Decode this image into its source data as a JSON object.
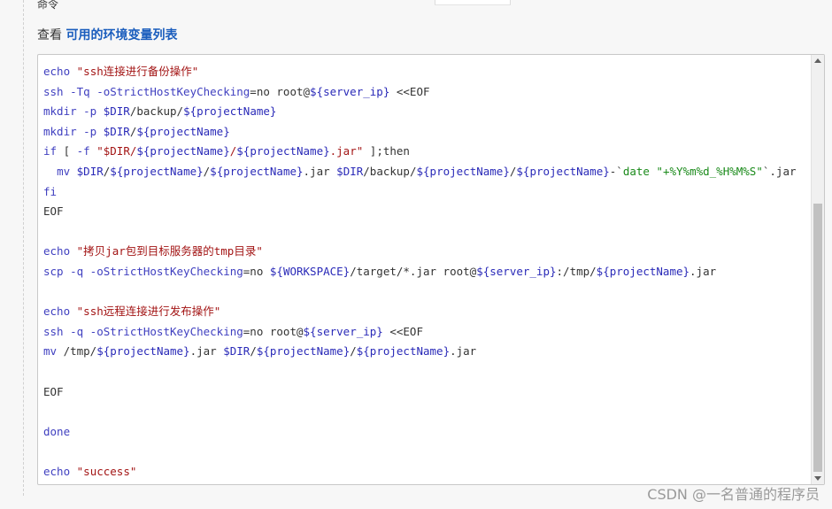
{
  "header": {
    "fragment": "命令",
    "help_prefix": "查看 ",
    "help_link": "可用的环境变量列表"
  },
  "editor": {
    "lines": [
      [
        {
          "t": "kw",
          "v": "echo "
        },
        {
          "t": "str",
          "v": "\"ssh连接进行备份操作\""
        }
      ],
      [
        {
          "t": "kw",
          "v": "ssh -Tq -oStrictHostKeyChecking"
        },
        {
          "t": "op",
          "v": "=no root@"
        },
        {
          "t": "var",
          "v": "${server_ip}"
        },
        {
          "t": "op",
          "v": " <<EOF"
        }
      ],
      [
        {
          "t": "kw",
          "v": "mkdir -p "
        },
        {
          "t": "var",
          "v": "$DIR"
        },
        {
          "t": "op",
          "v": "/backup/"
        },
        {
          "t": "var",
          "v": "${projectName}"
        }
      ],
      [
        {
          "t": "kw",
          "v": "mkdir -p "
        },
        {
          "t": "var",
          "v": "$DIR"
        },
        {
          "t": "op",
          "v": "/"
        },
        {
          "t": "var",
          "v": "${projectName}"
        }
      ],
      [
        {
          "t": "kw",
          "v": "if"
        },
        {
          "t": "op",
          "v": " [ "
        },
        {
          "t": "kw",
          "v": "-f "
        },
        {
          "t": "str",
          "v": "\"$DIR/"
        },
        {
          "t": "var",
          "v": "${projectName}"
        },
        {
          "t": "str",
          "v": "/"
        },
        {
          "t": "var",
          "v": "${projectName}"
        },
        {
          "t": "str",
          "v": ".jar\""
        },
        {
          "t": "op",
          "v": " ];then"
        }
      ],
      [
        {
          "t": "op",
          "v": "  "
        },
        {
          "t": "kw",
          "v": "mv "
        },
        {
          "t": "var",
          "v": "$DIR"
        },
        {
          "t": "op",
          "v": "/"
        },
        {
          "t": "var",
          "v": "${projectName}"
        },
        {
          "t": "op",
          "v": "/"
        },
        {
          "t": "var",
          "v": "${projectName}"
        },
        {
          "t": "op",
          "v": ".jar "
        },
        {
          "t": "var",
          "v": "$DIR"
        },
        {
          "t": "op",
          "v": "/backup/"
        },
        {
          "t": "var",
          "v": "${projectName}"
        },
        {
          "t": "op",
          "v": "/"
        },
        {
          "t": "var",
          "v": "${projectName}"
        },
        {
          "t": "op",
          "v": "-`"
        },
        {
          "t": "grn",
          "v": "date "
        },
        {
          "t": "grn",
          "v": "\"+%Y%m%d_%H%M%S\""
        },
        {
          "t": "op",
          "v": "`.jar"
        }
      ],
      [
        {
          "t": "kw",
          "v": "fi"
        }
      ],
      [
        {
          "t": "op",
          "v": "EOF"
        }
      ],
      [],
      [
        {
          "t": "kw",
          "v": "echo "
        },
        {
          "t": "str",
          "v": "\"拷贝jar包到目标服务器的tmp目录\""
        }
      ],
      [
        {
          "t": "kw",
          "v": "scp -q -oStrictHostKeyChecking"
        },
        {
          "t": "op",
          "v": "=no "
        },
        {
          "t": "var",
          "v": "${WORKSPACE}"
        },
        {
          "t": "op",
          "v": "/target/*.jar root@"
        },
        {
          "t": "var",
          "v": "${server_ip}"
        },
        {
          "t": "op",
          "v": ":/tmp/"
        },
        {
          "t": "var",
          "v": "${projectName}"
        },
        {
          "t": "op",
          "v": ".jar"
        }
      ],
      [],
      [
        {
          "t": "kw",
          "v": "echo "
        },
        {
          "t": "str",
          "v": "\"ssh远程连接进行发布操作\""
        }
      ],
      [
        {
          "t": "kw",
          "v": "ssh -q -oStrictHostKeyChecking"
        },
        {
          "t": "op",
          "v": "=no root@"
        },
        {
          "t": "var",
          "v": "${server_ip}"
        },
        {
          "t": "op",
          "v": " <<EOF"
        }
      ],
      [
        {
          "t": "kw",
          "v": "mv "
        },
        {
          "t": "op",
          "v": "/tmp/"
        },
        {
          "t": "var",
          "v": "${projectName}"
        },
        {
          "t": "op",
          "v": ".jar "
        },
        {
          "t": "var",
          "v": "$DIR"
        },
        {
          "t": "op",
          "v": "/"
        },
        {
          "t": "var",
          "v": "${projectName}"
        },
        {
          "t": "op",
          "v": "/"
        },
        {
          "t": "var",
          "v": "${projectName}"
        },
        {
          "t": "op",
          "v": ".jar"
        }
      ],
      [],
      [
        {
          "t": "op",
          "v": "EOF"
        }
      ],
      [],
      [
        {
          "t": "kw",
          "v": "done"
        }
      ],
      [],
      [
        {
          "t": "kw",
          "v": "echo "
        },
        {
          "t": "str",
          "v": "\"success\""
        }
      ]
    ]
  },
  "watermark": "CSDN @一名普通的程序员",
  "colors": {
    "keyword": "#4040c0",
    "variable": "#2a2ab8",
    "string": "#a31515",
    "date": "#1a8a1a",
    "link": "#1a5dbd"
  }
}
